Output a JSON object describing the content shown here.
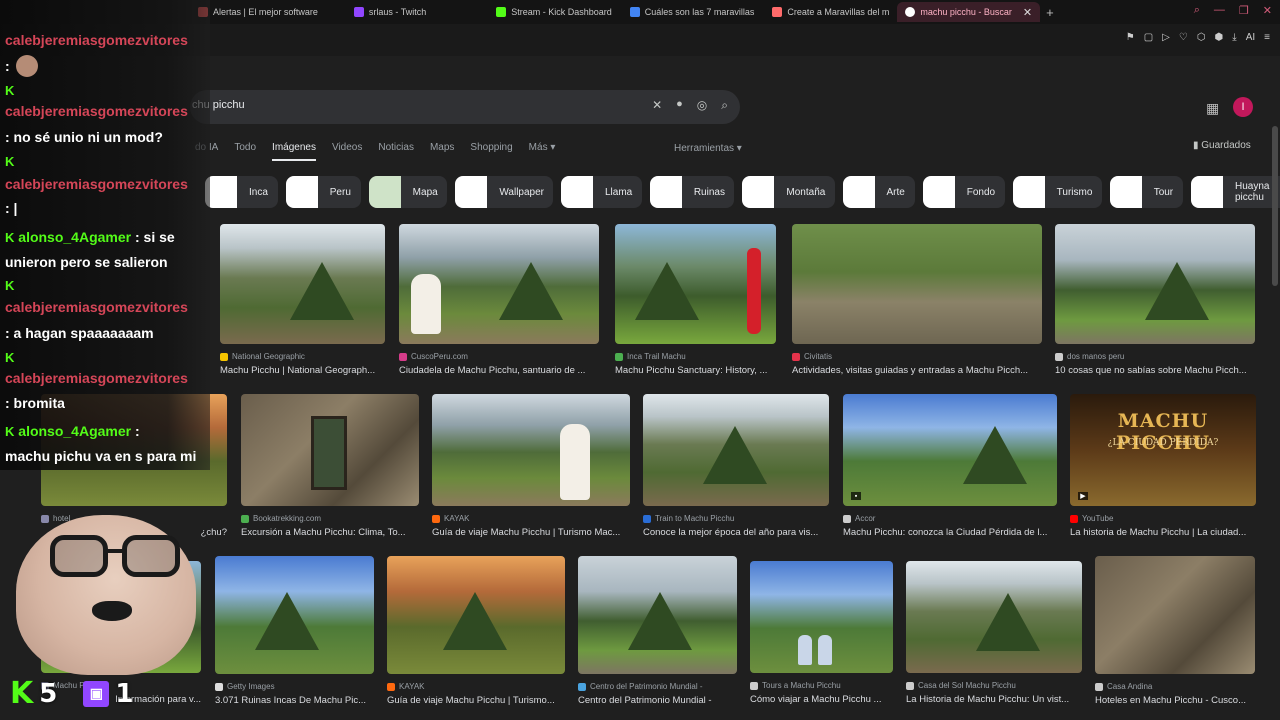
{
  "browser": {
    "tabs": [
      {
        "label": "Alertas | El mejor software",
        "color": "#ff5a5a"
      },
      {
        "label": "srlaus - Twitch",
        "color": "#9146ff"
      },
      {
        "label": "Stream - Kick Dashboard",
        "color": "#53fc18"
      },
      {
        "label": "Cuáles son las 7 maravillas",
        "color": "#4285f4"
      },
      {
        "label": "Create a Maravillas del m",
        "color": "#ff6b6b"
      },
      {
        "label": "machu picchu - Buscar",
        "color": "#ffffff",
        "active": true
      }
    ],
    "new_tab": "+",
    "window_controls": [
      "⌕",
      "—",
      "❐",
      "✕"
    ],
    "toolbar_icons": [
      "⚑",
      "▢",
      "▷",
      "♡",
      "⬡",
      "⬢",
      "⤓",
      "AI",
      "≡"
    ]
  },
  "search": {
    "query": "chu picchu",
    "clear_icon": "✕",
    "mic_icon": "🎤",
    "lens_icon": "◎",
    "search_icon": "⌕"
  },
  "header": {
    "apps_icon": "⋮⋮",
    "avatar_letter": "I"
  },
  "nav": {
    "tabs": [
      "do IA",
      "Todo",
      "Imágenes",
      "Videos",
      "Noticias",
      "Maps",
      "Shopping",
      "Más ▾"
    ],
    "active": "Imágenes",
    "tools": "Herramientas ▾",
    "saved": "Guardados"
  },
  "chips": [
    "Inca",
    "Peru",
    "Mapa",
    "Wallpaper",
    "Llama",
    "Ruinas",
    "Montaña",
    "Arte",
    "Fondo",
    "Turismo",
    "Tour",
    "Huayna picchu"
  ],
  "results_row1": [
    {
      "source": "National Geographic",
      "title": "Machu Picchu | National Geograph...",
      "color": "#f6c500"
    },
    {
      "source": "CuscoPeru.com",
      "title": "Ciudadela de Machu Picchu, santuario de ...",
      "color": "#d63c8a"
    },
    {
      "source": "Inca Trail Machu",
      "title": "Machu Picchu Sanctuary: History, ...",
      "color": "#4caf50"
    },
    {
      "source": "Civitatis",
      "title": "Actividades, visitas guiadas y entradas a Machu Picch...",
      "color": "#e5334b"
    },
    {
      "source": "dos manos peru",
      "title": "10 cosas que no sabías sobre Machu Picch...",
      "color": "#cccccc"
    }
  ],
  "results_row2": [
    {
      "source": "hotel",
      "title": "¿chu?",
      "color": "#8888aa"
    },
    {
      "source": "Bookatrekking.com",
      "title": "Excursión a Machu Picchu: Clima, To...",
      "color": "#4caf50"
    },
    {
      "source": "KAYAK",
      "title": "Guía de viaje Machu Picchu | Turismo Mac...",
      "color": "#ff690f"
    },
    {
      "source": "Train to Machu Picchu",
      "title": "Conoce la mejor época del año para vis...",
      "color": "#2a6dd6"
    },
    {
      "source": "Accor",
      "title": "Machu Picchu: conozca la Ciudad Pérdida de l...",
      "color": "#cccccc"
    },
    {
      "source": "YouTube",
      "title": "La historia de Machu Picchu | La ciudad...",
      "color": "#ff0000"
    }
  ],
  "results_row3": [
    {
      "source": "Machu Picchu",
      "title": "Información para v...",
      "color": "#8888aa"
    },
    {
      "source": "Getty Images",
      "title": "3.071 Ruinas Incas De Machu Pic...",
      "color": "#dddddd"
    },
    {
      "source": "KAYAK",
      "title": "Guía de viaje Machu Picchu | Turismo...",
      "color": "#ff690f"
    },
    {
      "source": "Centro del Patrimonio Mundial -",
      "title": "Centro del Patrimonio Mundial -",
      "color": "#4aa3df"
    },
    {
      "source": "Tours a Machu Picchu",
      "title": "Cómo viajar a Machu Picchu ...",
      "color": "#cccccc"
    },
    {
      "source": "Casa del Sol Machu Picchu",
      "title": "La Historia de Machu Picchu: Un vist...",
      "color": "#cccccc"
    },
    {
      "source": "Casa Andina",
      "title": "Hoteles en Machu Picchu - Cusco...",
      "color": "#cccccc"
    }
  ],
  "thumb_text": {
    "mp_title": "MACHU PICCHU",
    "mp_sub": "¿LA CIUDAD PERDIDA?"
  },
  "chat": {
    "k": "K",
    "lines": [
      {
        "user": "calebjeremiasgomezvitores",
        "msg": ":"
      },
      {
        "user": "calebjeremiasgomezvitores",
        "msg": ": no sé unio ni un mod?"
      },
      {
        "user": "calebjeremiasgomezvitores",
        "msg": ": |"
      },
      {
        "user": "alonso_4Agamer",
        "msg": ": si se"
      },
      {
        "user": "",
        "msg": "unieron pero se salieron"
      },
      {
        "user": "calebjeremiasgomezvitores",
        "msg": ": a hagan spaaaaaaam"
      },
      {
        "user": "calebjeremiasgomezvitores",
        "msg": ": bromita"
      },
      {
        "user": "alonso_4Agamer",
        "msg": ":"
      },
      {
        "user": "",
        "msg": "machu pichu va en s para mi"
      }
    ]
  },
  "stats": {
    "kick_label": "K",
    "kick_count": "5",
    "twitch_label": "▣",
    "twitch_count": "1"
  }
}
